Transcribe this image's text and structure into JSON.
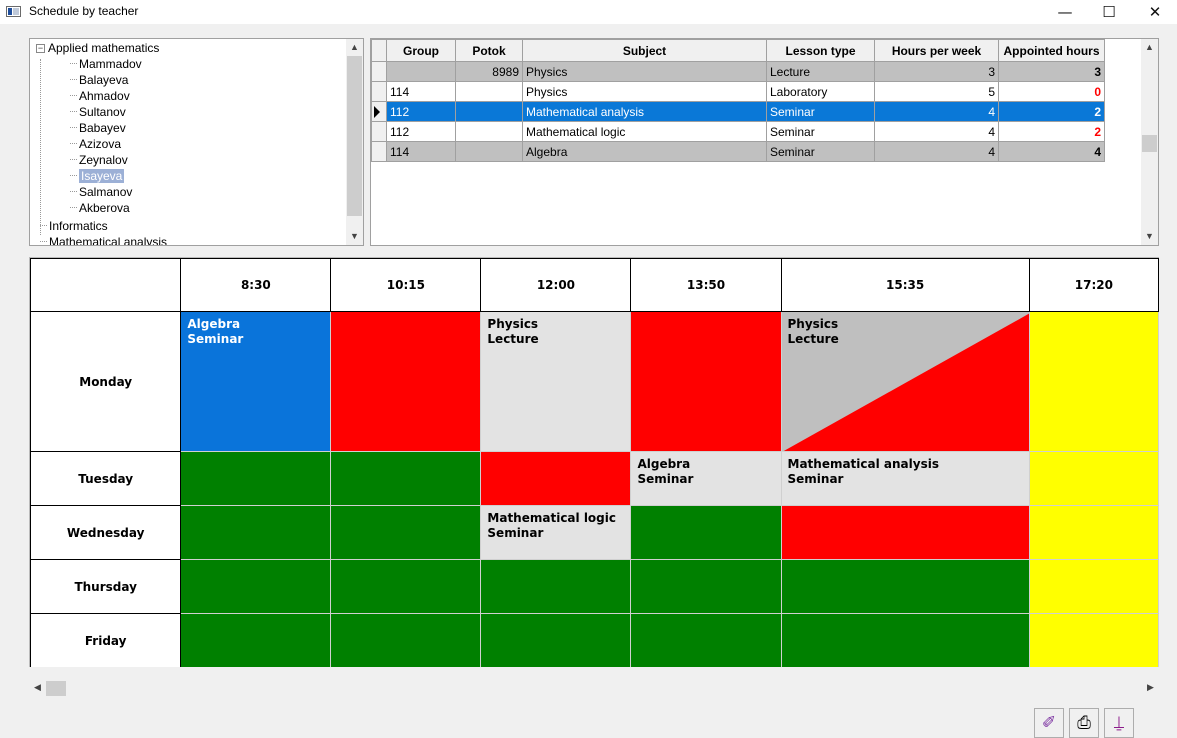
{
  "window": {
    "title": "Schedule by teacher",
    "minimize_glyph": "—",
    "maximize_glyph": "☐",
    "close_glyph": "✕"
  },
  "tree": {
    "root_expander": "−",
    "root_label": "Applied mathematics",
    "children": [
      "Mammadov",
      "Balayeva",
      "Ahmadov",
      "Sultanov",
      "Babayev",
      "Azizova",
      "Zeynalov",
      "Isayeva",
      "Salmanov",
      "Akberova"
    ],
    "selected": "Isayeva",
    "next_label": "Informatics",
    "partial_label": "Mathematical analysis"
  },
  "grid": {
    "columns": [
      "Group",
      "Potok",
      "Subject",
      "Lesson type",
      "Hours per week",
      "Appointed hours"
    ],
    "rows": [
      {
        "group": "",
        "potok": "8989",
        "subject": "Physics",
        "type": "Lecture",
        "hours": "3",
        "appointed": "3",
        "appointed_color": "#000000",
        "style": "gray"
      },
      {
        "group": "114",
        "potok": "",
        "subject": "Physics",
        "type": "Laboratory",
        "hours": "5",
        "appointed": "0",
        "appointed_color": "#ff0000",
        "style": "white"
      },
      {
        "group": "112",
        "potok": "",
        "subject": "Mathematical analysis",
        "type": "Seminar",
        "hours": "4",
        "appointed": "2",
        "appointed_color": "#ffffff",
        "style": "sel"
      },
      {
        "group": "112",
        "potok": "",
        "subject": "Mathematical logic",
        "type": "Seminar",
        "hours": "4",
        "appointed": "2",
        "appointed_color": "#ff0000",
        "style": "white"
      },
      {
        "group": "114",
        "potok": "",
        "subject": "Algebra",
        "type": "Seminar",
        "hours": "4",
        "appointed": "4",
        "appointed_color": "#000000",
        "style": "gray"
      }
    ]
  },
  "schedule": {
    "times": [
      "8:30",
      "10:15",
      "12:00",
      "13:50",
      "15:35",
      "17:20"
    ],
    "days": [
      "Monday",
      "Tuesday",
      "Wednesday",
      "Thursday",
      "Friday"
    ],
    "colors": {
      "red": "#ff0000",
      "green": "#008000",
      "yellow": "#ffff00",
      "blue": "#0a74da",
      "light": "#e3e3e3",
      "gray": "#bfbfbf"
    },
    "cells": {
      "mon_830": {
        "subject": "Algebra",
        "type": "Seminar"
      },
      "mon_1200": {
        "subject": "Physics",
        "type": "Lecture"
      },
      "mon_1535": {
        "subject": "Physics",
        "type": "Lecture"
      },
      "tue_1350": {
        "subject": "Algebra",
        "type": "Seminar"
      },
      "tue_1535": {
        "subject": "Mathematical analysis",
        "type": "Seminar"
      },
      "wed_1200": {
        "subject": "Mathematical logic",
        "type": "Seminar"
      }
    }
  },
  "toolbar": {
    "edit_icon": "✐",
    "print_icon": "⎙",
    "exit_icon": "⍊"
  }
}
